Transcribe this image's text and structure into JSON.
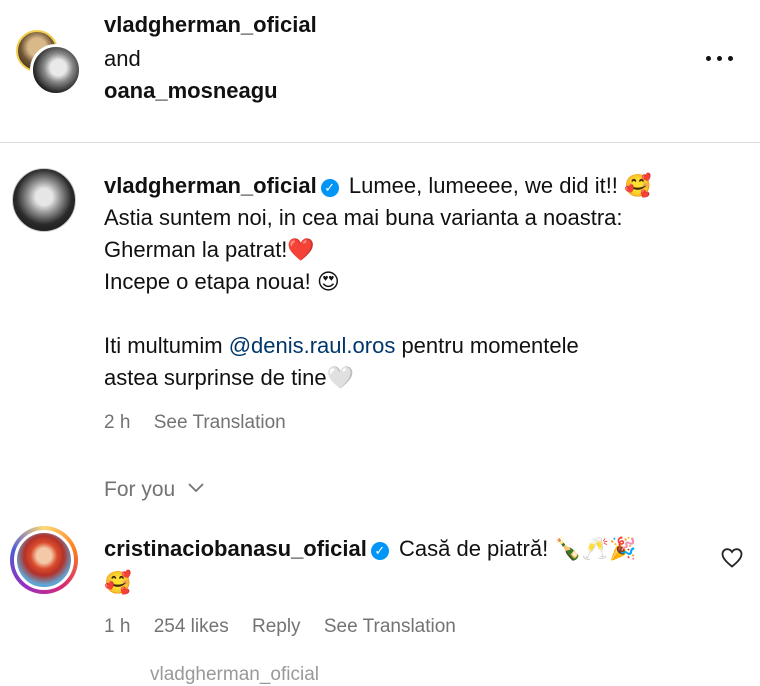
{
  "header": {
    "user1": "vladgherman_oficial",
    "and": " and",
    "user2": "oana_mosneagu",
    "more_icon": "more-horizontal-icon"
  },
  "post": {
    "username": "vladgherman_oficial",
    "verified_icon": "verified-badge-icon",
    "line1": "Lumee, lumeeee, we did it!! 🥰",
    "line2": "Astia suntem noi, in cea mai buna varianta a noastra:",
    "line3": "Gherman la patrat!❤️",
    "line4": "Incepe o etapa noua! 😍",
    "line5_pre": "Iti multumim ",
    "mention": "@denis.raul.oros",
    "line5_post": " pentru momentele",
    "line6": "astea surprinse de tine🤍",
    "time": "2 h",
    "see_translation": "See Translation"
  },
  "section": {
    "label": "For you",
    "chevron_icon": "chevron-down-icon"
  },
  "comment": {
    "username": "cristinaciobanasu_oficial",
    "verified_icon": "verified-badge-icon",
    "text": "Casă de piatră! 🍾🥂🎉",
    "emoji_line": "🥰",
    "time": "1 h",
    "likes": "254 likes",
    "reply": "Reply",
    "see_translation": "See Translation",
    "like_icon": "heart-outline-icon"
  },
  "cutoff_text": "vladgherman_oficial"
}
